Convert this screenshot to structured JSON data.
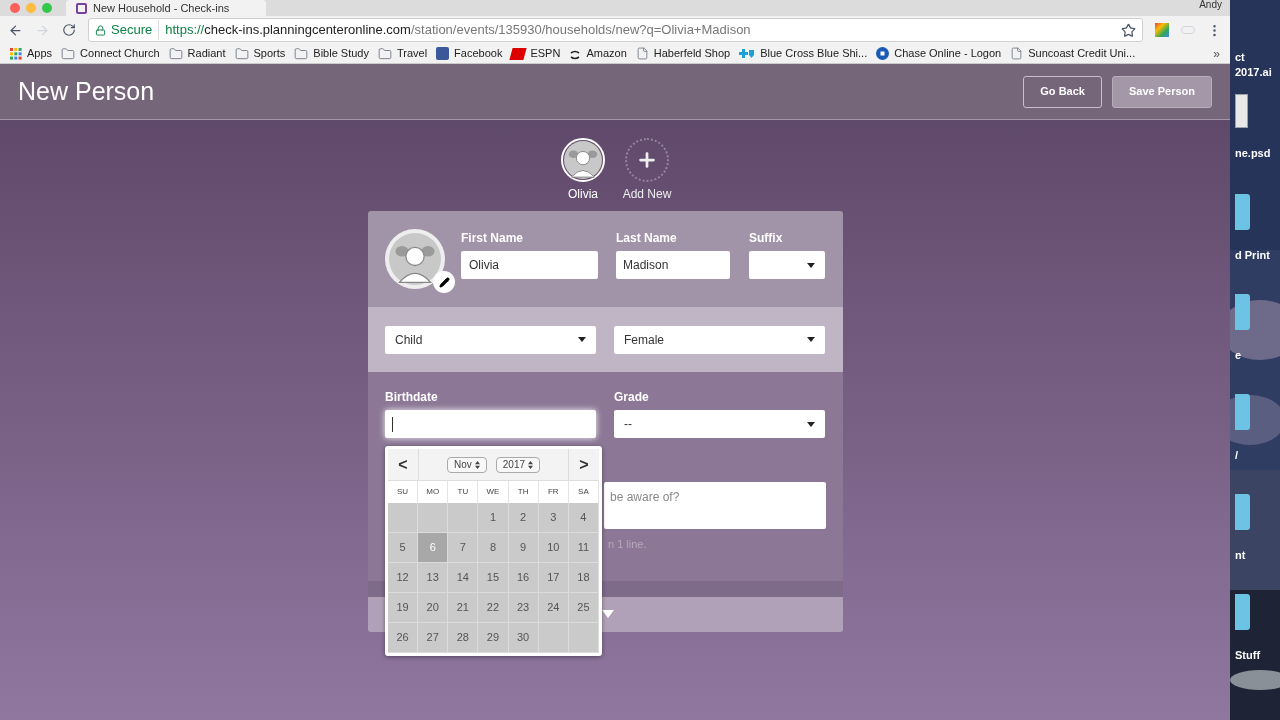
{
  "browser": {
    "tab_title": "New Household - Check-ins",
    "profile": "Andy",
    "secure_label": "Secure",
    "url_scheme": "https://",
    "url_host": "check-ins.planningcenteronline.com",
    "url_path": "/station/events/135930/households/new?q=Olivia+Madison",
    "bookmarks": [
      {
        "label": "Apps",
        "kind": "apps"
      },
      {
        "label": "Connect Church",
        "kind": "folder"
      },
      {
        "label": "Radiant",
        "kind": "folder"
      },
      {
        "label": "Sports",
        "kind": "folder"
      },
      {
        "label": "Bible Study",
        "kind": "folder"
      },
      {
        "label": "Travel",
        "kind": "folder"
      },
      {
        "label": "Facebook",
        "kind": "facebook"
      },
      {
        "label": "ESPN",
        "kind": "espn"
      },
      {
        "label": "Amazon",
        "kind": "amazon"
      },
      {
        "label": "Haberfeld Shop",
        "kind": "page"
      },
      {
        "label": "Blue Cross Blue Shi...",
        "kind": "cross"
      },
      {
        "label": "Chase Online - Logon",
        "kind": "chase"
      },
      {
        "label": "Suncoast Credit Uni...",
        "kind": "page"
      }
    ],
    "more": "»"
  },
  "header": {
    "title": "New Person",
    "buttons": [
      {
        "label": "Go Back",
        "kind": "outline"
      },
      {
        "label": "Save Person",
        "kind": "filled"
      }
    ]
  },
  "people": [
    {
      "name": "Olivia",
      "kind": "person",
      "selected": true
    },
    {
      "name": "Add New",
      "kind": "add",
      "selected": false
    }
  ],
  "form": {
    "first_name": {
      "label": "First Name",
      "value": "Olivia"
    },
    "last_name": {
      "label": "Last Name",
      "value": "Madison"
    },
    "suffix": {
      "label": "Suffix"
    },
    "type_select": "Child",
    "gender_select": "Female",
    "birthdate": {
      "label": "Birthdate",
      "focused": true
    },
    "grade": {
      "label": "Grade",
      "value": "--"
    },
    "notes_placeholder": "be aware of?",
    "notes_hint": "n 1 line."
  },
  "calendar": {
    "prev": "<",
    "next": ">",
    "month": "Nov",
    "year": "2017",
    "weekdays": [
      "SU",
      "MO",
      "TU",
      "WE",
      "TH",
      "FR",
      "SA"
    ],
    "weeks": [
      [
        {
          "kind": "blank"
        },
        {
          "kind": "blank"
        },
        {
          "kind": "blank"
        },
        {
          "kind": "day",
          "label": "1",
          "selected": false
        },
        {
          "kind": "day",
          "label": "2",
          "selected": false
        },
        {
          "kind": "day",
          "label": "3",
          "selected": false
        },
        {
          "kind": "day",
          "label": "4",
          "selected": false
        }
      ],
      [
        {
          "kind": "day",
          "label": "5",
          "selected": false
        },
        {
          "kind": "day",
          "label": "6",
          "selected": true
        },
        {
          "kind": "day",
          "label": "7",
          "selected": false
        },
        {
          "kind": "day",
          "label": "8",
          "selected": false
        },
        {
          "kind": "day",
          "label": "9",
          "selected": false
        },
        {
          "kind": "day",
          "label": "10",
          "selected": false
        },
        {
          "kind": "day",
          "label": "11",
          "selected": false
        }
      ],
      [
        {
          "kind": "day",
          "label": "12",
          "selected": false
        },
        {
          "kind": "day",
          "label": "13",
          "selected": false
        },
        {
          "kind": "day",
          "label": "14",
          "selected": false
        },
        {
          "kind": "day",
          "label": "15",
          "selected": false
        },
        {
          "kind": "day",
          "label": "16",
          "selected": false
        },
        {
          "kind": "day",
          "label": "17",
          "selected": false
        },
        {
          "kind": "day",
          "label": "18",
          "selected": false
        }
      ],
      [
        {
          "kind": "day",
          "label": "19",
          "selected": false
        },
        {
          "kind": "day",
          "label": "20",
          "selected": false
        },
        {
          "kind": "day",
          "label": "21",
          "selected": false
        },
        {
          "kind": "day",
          "label": "22",
          "selected": false
        },
        {
          "kind": "day",
          "label": "23",
          "selected": false
        },
        {
          "kind": "day",
          "label": "24",
          "selected": false
        },
        {
          "kind": "day",
          "label": "25",
          "selected": false
        }
      ],
      [
        {
          "kind": "day",
          "label": "26",
          "selected": false
        },
        {
          "kind": "day",
          "label": "27",
          "selected": false
        },
        {
          "kind": "day",
          "label": "28",
          "selected": false
        },
        {
          "kind": "day",
          "label": "29",
          "selected": false
        },
        {
          "kind": "day",
          "label": "30",
          "selected": false
        },
        {
          "kind": "blank"
        },
        {
          "kind": "blank"
        }
      ]
    ]
  },
  "desktop": [
    {
      "label": "ct 2017.ai",
      "kind": "none"
    },
    {
      "label": "ne.psd",
      "kind": "file"
    },
    {
      "label": "d Print",
      "kind": "folder"
    },
    {
      "label": "e",
      "kind": "folder"
    },
    {
      "label": "/",
      "kind": "folder"
    },
    {
      "label": "nt",
      "kind": "folder"
    },
    {
      "label": "Stuff",
      "kind": "folder"
    }
  ]
}
